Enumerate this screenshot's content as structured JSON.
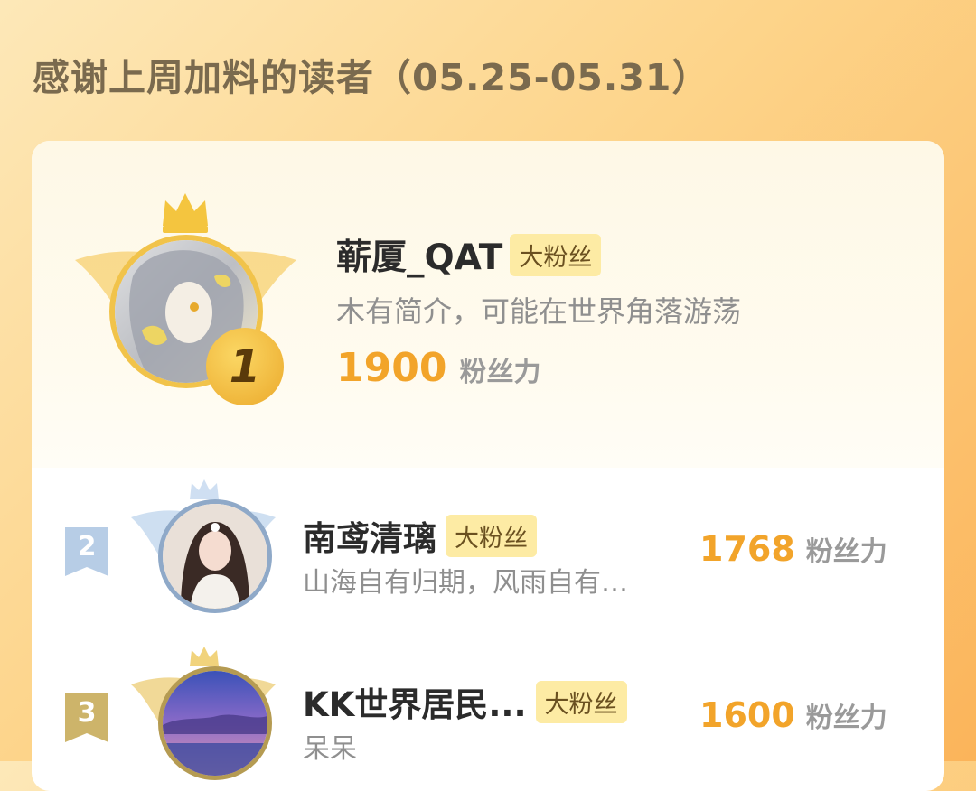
{
  "heading": "感谢上周加料的读者（05.25-05.31）",
  "tag_label": "大粉丝",
  "score_unit": "粉丝力",
  "readers": [
    {
      "rank": "1",
      "name": "蕲厦_QAT",
      "bio": "木有简介，可能在世界角落游荡",
      "score": "1900"
    },
    {
      "rank": "2",
      "name": "南鸢清璃",
      "bio": "山海自有归期，风雨自有…",
      "score": "1768"
    },
    {
      "rank": "3",
      "name": "KK世界居民...",
      "bio": "呆呆",
      "score": "1600"
    }
  ],
  "colors": {
    "gold": "#f2a42a",
    "silver": "#a9c1dc",
    "bronze": "#c9ac61"
  },
  "icons": {
    "crown": "crown-icon",
    "wings": "wings-icon"
  }
}
